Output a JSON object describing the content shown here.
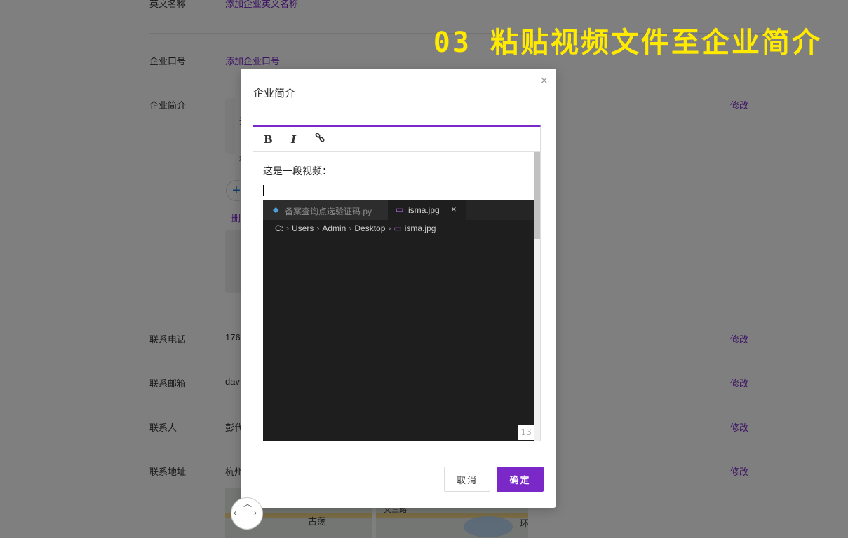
{
  "page": {
    "rows": [
      {
        "label": "英文名称",
        "value": "添加企业英文名称",
        "edit": ""
      },
      {
        "label": "企业口号",
        "value": "添加企业口号",
        "edit": ""
      },
      {
        "label": "企业简介",
        "value": "",
        "edit": "修改"
      },
      {
        "label": "联系电话",
        "value": "176",
        "edit": "修改"
      },
      {
        "label": "联系邮箱",
        "value": "dav",
        "edit": "修改"
      },
      {
        "label": "联系人",
        "value": "彭代",
        "edit": "修改"
      },
      {
        "label": "联系地址",
        "value": "杭州",
        "edit": "修改"
      }
    ],
    "intro_fragments": [
      "这",
      "杭"
    ],
    "plus": "+",
    "delete_fragment": "删",
    "map_labels": [
      "古荡",
      "文三路",
      "环"
    ]
  },
  "caption": "03 粘贴视频文件至企业简介",
  "modal": {
    "title": "企业简介",
    "close": "×",
    "toolbar": {
      "bold": "B",
      "italic": "I"
    },
    "text": "这是一段视频：",
    "screenshot": {
      "tab1": "备案查询点选验证码.py",
      "tab2": "isma.jpg",
      "tab_close": "×",
      "breadcrumbs": [
        "C:",
        "Users",
        "Admin",
        "Desktop",
        "isma.jpg"
      ]
    },
    "zoom": "13",
    "cancel": "取消",
    "confirm": "确定"
  },
  "colors": {
    "accent": "#7b28c8",
    "caption": "#ffea00"
  }
}
